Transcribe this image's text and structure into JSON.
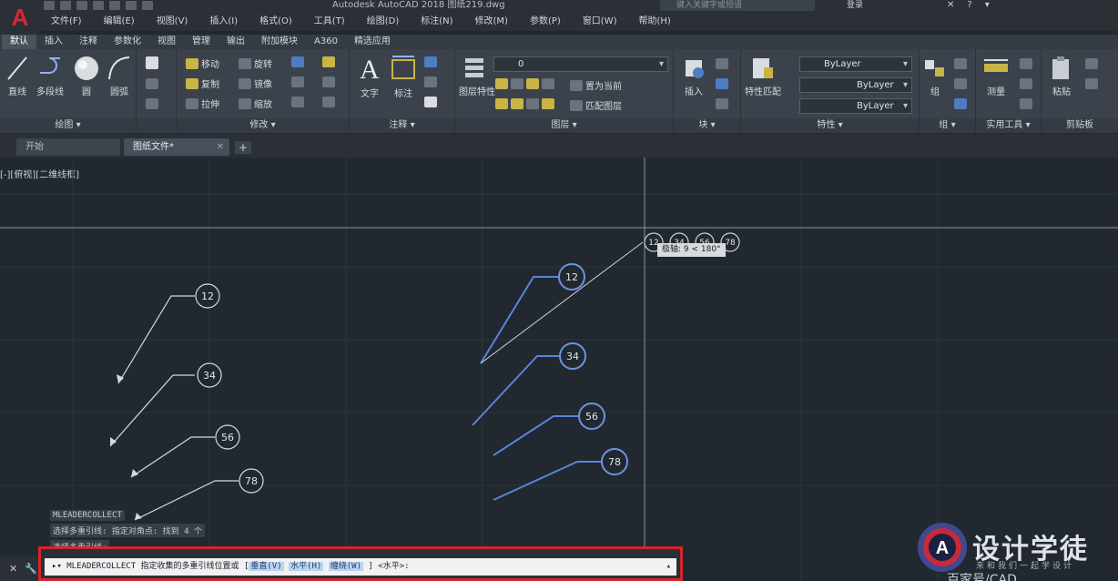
{
  "window": {
    "title": "Autodesk AutoCAD 2018    图纸219.dwg",
    "search_placeholder": "键入关键字或短语",
    "signin": "登录"
  },
  "menubar": [
    "文件(F)",
    "编辑(E)",
    "视图(V)",
    "插入(I)",
    "格式(O)",
    "工具(T)",
    "绘图(D)",
    "标注(N)",
    "修改(M)",
    "参数(P)",
    "窗口(W)",
    "帮助(H)"
  ],
  "ribbon_tabs": [
    "默认",
    "插入",
    "注释",
    "参数化",
    "视图",
    "管理",
    "输出",
    "附加模块",
    "A360",
    "精选应用"
  ],
  "ribbon": {
    "draw": {
      "title": "绘图 ▾",
      "line": "直线",
      "polyline": "多段线",
      "circle": "圆",
      "arc": "圆弧"
    },
    "modify": {
      "title": "修改 ▾",
      "move": "移动",
      "rotate": "旋转",
      "copy": "复制",
      "mirror": "镜像",
      "stretch": "拉伸",
      "scale": "缩放"
    },
    "annotation": {
      "title": "注释 ▾",
      "text": "文字",
      "dimension": "标注"
    },
    "layers": {
      "title": "图层 ▾",
      "properties": "图层特性",
      "layer_value": "0",
      "make_current": "置为当前",
      "match_layer": "匹配图层"
    },
    "block": {
      "title": "块 ▾",
      "insert": "插入"
    },
    "properties": {
      "title": "特性 ▾",
      "match": "特性匹配",
      "bylayer1": "ByLayer",
      "bylayer2": "ByLayer",
      "bylayer3": "ByLayer"
    },
    "groups": {
      "title": "组 ▾",
      "group": "组"
    },
    "utilities": {
      "title": "实用工具 ▾",
      "measure": "测量"
    },
    "clipboard": {
      "title": "剪贴板",
      "paste": "粘贴"
    }
  },
  "doc_tabs": {
    "start": "开始",
    "drawing": "图纸文件*"
  },
  "viewport_label": "[-][俯视][二维线框]",
  "balloons": {
    "left": [
      "12",
      "34",
      "56",
      "78"
    ],
    "right": [
      "12",
      "34",
      "56",
      "78"
    ],
    "preview": [
      "12",
      "34",
      "56",
      "78"
    ]
  },
  "tooltip": "极轴: 9 < 180°",
  "command_history": [
    "MLEADERCOLLECT",
    "选择多重引线: 指定对角点: 找到 4 个",
    "选择多重引线:"
  ],
  "command_line": {
    "prefix": "MLEADERCOLLECT 指定收集的多重引线位置或 [",
    "opt1": "垂直(V)",
    "opt2": "水平(H)",
    "opt3": "缠绕(W)",
    "suffix": "] <水平>:"
  },
  "watermark": {
    "title": "设计学徒",
    "subtitle": "来和我们一起学设计",
    "bottom": "百家号/CAD"
  },
  "colors": {
    "canvas_bg": "#212830",
    "selected_leader": "#5b84d8",
    "command_highlight": "#d6252a"
  }
}
